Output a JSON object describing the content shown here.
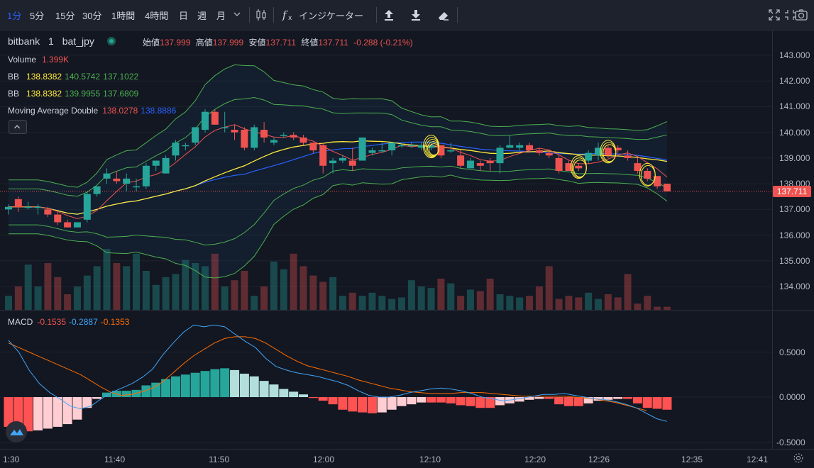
{
  "toolbar": {
    "intervals": [
      "1分",
      "5分",
      "15分",
      "30分",
      "1時間",
      "4時間",
      "日",
      "週",
      "月"
    ],
    "active_interval": "1分",
    "indicators_label": "インジケーター",
    "icons": [
      "chevron-down-icon",
      "candles-icon",
      "fx-icon",
      "upload-icon",
      "download-icon",
      "eraser-icon",
      "fullscreen-icon",
      "restore-icon",
      "camera-icon"
    ]
  },
  "symbol": {
    "exchange": "bitbank",
    "interval": "1",
    "pair": "bat_jpy"
  },
  "ohlc": {
    "open_label": "始値",
    "open": "137.999",
    "high_label": "高値",
    "high": "137.999",
    "low_label": "安値",
    "low": "137.711",
    "close_label": "終値",
    "close": "137.711",
    "change": "-0.288 (-0.21%)"
  },
  "legends": {
    "volume": {
      "label": "Volume",
      "value": "1.399K"
    },
    "bb1": {
      "label": "BB",
      "v1": "138.8382",
      "v2": "140.5742",
      "v3": "137.1022"
    },
    "bb2": {
      "label": "BB",
      "v1": "138.8382",
      "v2": "139.9955",
      "v3": "137.6809"
    },
    "mad": {
      "label": "Moving Average Double",
      "v1": "138.0278",
      "v2": "138.8886"
    },
    "macd": {
      "label": "MACD",
      "v1": "-0.1535",
      "v2": "-0.2887",
      "v3": "-0.1353"
    }
  },
  "price_scale": [
    "143.000",
    "142.000",
    "141.000",
    "140.000",
    "139.000",
    "138.000",
    "137.000",
    "136.000",
    "135.000",
    "134.000"
  ],
  "last_price": "137.711",
  "macd_scale": [
    "0.5000",
    "0.0000",
    "-0.5000"
  ],
  "time_scale": [
    "1:30",
    "11:40",
    "11:50",
    "12:00",
    "12:10",
    "12:20",
    "12:26",
    "12:35",
    "12:41"
  ],
  "colors": {
    "up": "#26a69a",
    "down": "#ef5350",
    "bb_mid": "#ffeb3b",
    "bb_band": "#4caf50",
    "ma_fast": "#ef5350",
    "ma_slow": "#2962ff",
    "macd_line": "#42a5f5",
    "signal_line": "#ff6d00",
    "annotation": "#ffeb3b"
  },
  "chart_data": {
    "type": "candlestick",
    "interval": "1 minute",
    "ylim": [
      133.5,
      143.3
    ],
    "candles": [
      {
        "o": 137.0,
        "h": 137.2,
        "l": 136.8,
        "c": 137.1
      },
      {
        "o": 137.4,
        "h": 137.5,
        "l": 136.9,
        "c": 137.1
      },
      {
        "o": 137.1,
        "h": 137.3,
        "l": 137.0,
        "c": 137.1
      },
      {
        "o": 137.1,
        "h": 137.2,
        "l": 136.8,
        "c": 137.1
      },
      {
        "o": 137.0,
        "h": 137.1,
        "l": 136.7,
        "c": 136.8
      },
      {
        "o": 136.8,
        "h": 136.9,
        "l": 136.4,
        "c": 136.5
      },
      {
        "o": 136.5,
        "h": 136.6,
        "l": 136.3,
        "c": 136.3
      },
      {
        "o": 136.3,
        "h": 136.5,
        "l": 136.3,
        "c": 136.5
      },
      {
        "o": 136.6,
        "h": 137.7,
        "l": 136.5,
        "c": 137.6
      },
      {
        "o": 137.6,
        "h": 137.9,
        "l": 137.5,
        "c": 137.9
      },
      {
        "o": 138.2,
        "h": 138.6,
        "l": 138.0,
        "c": 138.4
      },
      {
        "o": 138.2,
        "h": 138.5,
        "l": 138.0,
        "c": 138.1
      },
      {
        "o": 138.0,
        "h": 138.4,
        "l": 137.7,
        "c": 138.2
      },
      {
        "o": 137.9,
        "h": 138.2,
        "l": 137.7,
        "c": 137.9
      },
      {
        "o": 137.9,
        "h": 138.8,
        "l": 137.8,
        "c": 138.7
      },
      {
        "o": 138.7,
        "h": 138.9,
        "l": 138.5,
        "c": 138.9
      },
      {
        "o": 138.4,
        "h": 139.1,
        "l": 138.4,
        "c": 139.0
      },
      {
        "o": 139.1,
        "h": 139.7,
        "l": 138.9,
        "c": 139.6
      },
      {
        "o": 139.5,
        "h": 139.6,
        "l": 139.3,
        "c": 139.5
      },
      {
        "o": 139.6,
        "h": 140.2,
        "l": 139.5,
        "c": 140.2
      },
      {
        "o": 140.1,
        "h": 140.9,
        "l": 140.0,
        "c": 140.8
      },
      {
        "o": 140.8,
        "h": 140.9,
        "l": 140.3,
        "c": 140.3
      },
      {
        "o": 140.2,
        "h": 140.8,
        "l": 140.0,
        "c": 140.2
      },
      {
        "o": 140.1,
        "h": 140.3,
        "l": 139.7,
        "c": 140.0
      },
      {
        "o": 140.1,
        "h": 140.2,
        "l": 139.3,
        "c": 139.4
      },
      {
        "o": 139.4,
        "h": 140.3,
        "l": 139.3,
        "c": 140.2
      },
      {
        "o": 140.1,
        "h": 140.4,
        "l": 139.6,
        "c": 139.8
      },
      {
        "o": 139.6,
        "h": 139.8,
        "l": 139.5,
        "c": 139.7
      },
      {
        "o": 139.9,
        "h": 140.0,
        "l": 139.8,
        "c": 139.9
      },
      {
        "o": 139.9,
        "h": 140.0,
        "l": 139.7,
        "c": 139.8
      },
      {
        "o": 139.8,
        "h": 139.9,
        "l": 139.5,
        "c": 139.6
      },
      {
        "o": 139.6,
        "h": 139.6,
        "l": 139.2,
        "c": 139.3
      },
      {
        "o": 139.5,
        "h": 139.6,
        "l": 138.4,
        "c": 138.7
      },
      {
        "o": 138.8,
        "h": 139.0,
        "l": 138.4,
        "c": 138.9
      },
      {
        "o": 138.9,
        "h": 139.1,
        "l": 138.8,
        "c": 139.0
      },
      {
        "o": 138.9,
        "h": 139.4,
        "l": 138.5,
        "c": 138.7
      },
      {
        "o": 138.9,
        "h": 139.8,
        "l": 138.9,
        "c": 139.8
      },
      {
        "o": 139.2,
        "h": 139.4,
        "l": 139.1,
        "c": 139.3
      },
      {
        "o": 139.3,
        "h": 139.6,
        "l": 139.2,
        "c": 139.3
      },
      {
        "o": 139.3,
        "h": 139.6,
        "l": 139.1,
        "c": 139.6
      },
      {
        "o": 139.5,
        "h": 139.6,
        "l": 139.4,
        "c": 139.5
      },
      {
        "o": 139.5,
        "h": 139.6,
        "l": 139.4,
        "c": 139.5
      },
      {
        "o": 139.4,
        "h": 139.6,
        "l": 139.3,
        "c": 139.5
      },
      {
        "o": 139.4,
        "h": 139.6,
        "l": 139.3,
        "c": 139.5
      },
      {
        "o": 139.5,
        "h": 139.5,
        "l": 139.0,
        "c": 139.1
      },
      {
        "o": 139.3,
        "h": 139.6,
        "l": 139.2,
        "c": 139.3
      },
      {
        "o": 139.1,
        "h": 139.3,
        "l": 138.6,
        "c": 138.7
      },
      {
        "o": 138.6,
        "h": 139.0,
        "l": 138.6,
        "c": 138.9
      },
      {
        "o": 138.8,
        "h": 138.9,
        "l": 138.5,
        "c": 138.7
      },
      {
        "o": 138.9,
        "h": 139.0,
        "l": 138.5,
        "c": 138.8
      },
      {
        "o": 138.8,
        "h": 139.5,
        "l": 138.4,
        "c": 139.4
      },
      {
        "o": 139.4,
        "h": 139.9,
        "l": 139.4,
        "c": 139.5
      },
      {
        "o": 139.4,
        "h": 139.6,
        "l": 139.3,
        "c": 139.5
      },
      {
        "o": 139.5,
        "h": 139.6,
        "l": 139.2,
        "c": 139.3
      },
      {
        "o": 139.3,
        "h": 139.4,
        "l": 139.1,
        "c": 139.2
      },
      {
        "o": 139.2,
        "h": 139.3,
        "l": 139.0,
        "c": 139.1
      },
      {
        "o": 139.0,
        "h": 139.1,
        "l": 138.4,
        "c": 138.5
      },
      {
        "o": 138.8,
        "h": 138.9,
        "l": 138.5,
        "c": 138.5
      },
      {
        "o": 138.7,
        "h": 138.8,
        "l": 138.5,
        "c": 138.6
      },
      {
        "o": 138.9,
        "h": 139.3,
        "l": 138.8,
        "c": 139.2
      },
      {
        "o": 139.1,
        "h": 139.6,
        "l": 138.9,
        "c": 139.4
      },
      {
        "o": 139.4,
        "h": 139.5,
        "l": 139.0,
        "c": 139.1
      },
      {
        "o": 139.4,
        "h": 139.5,
        "l": 139.2,
        "c": 139.3
      },
      {
        "o": 139.1,
        "h": 139.3,
        "l": 138.9,
        "c": 139.0
      },
      {
        "o": 138.8,
        "h": 139.0,
        "l": 138.4,
        "c": 138.5
      },
      {
        "o": 138.5,
        "h": 138.6,
        "l": 138.1,
        "c": 138.2
      },
      {
        "o": 138.3,
        "h": 138.3,
        "l": 137.8,
        "c": 137.9
      },
      {
        "o": 138.0,
        "h": 138.0,
        "l": 137.7,
        "c": 137.7
      }
    ],
    "volume": [
      0.9,
      1.5,
      2.9,
      1.5,
      3.0,
      2.1,
      1.0,
      1.5,
      2.2,
      2.8,
      3.9,
      3.0,
      2.8,
      3.6,
      2.5,
      1.6,
      2.1,
      2.3,
      3.2,
      3.0,
      2.8,
      3.6,
      1.5,
      1.9,
      2.5,
      0.9,
      1.5,
      3.1,
      2.6,
      3.6,
      2.8,
      2.2,
      1.8,
      2.1,
      0.9,
      1.1,
      0.9,
      1.1,
      0.9,
      0.7,
      0.8,
      1.9,
      1.5,
      1.4,
      2.0,
      1.7,
      0.9,
      1.3,
      1.2,
      2.0,
      1.0,
      0.9,
      0.8,
      0.9,
      1.5,
      2.8,
      0.7,
      0.9,
      0.8,
      1.1,
      0.7,
      1.0,
      0.8,
      2.3,
      0.4,
      0.9,
      0.2,
      0.2
    ],
    "macd_ylim": [
      -0.55,
      0.95
    ],
    "macd_hist": [
      -0.33,
      -0.36,
      -0.38,
      -0.37,
      -0.35,
      -0.33,
      -0.3,
      -0.25,
      -0.12,
      -0.02,
      0.05,
      0.07,
      0.07,
      0.08,
      0.13,
      0.16,
      0.2,
      0.23,
      0.25,
      0.27,
      0.29,
      0.31,
      0.32,
      0.3,
      0.26,
      0.23,
      0.18,
      0.14,
      0.09,
      0.06,
      0.03,
      -0.01,
      -0.04,
      -0.08,
      -0.14,
      -0.16,
      -0.17,
      -0.18,
      -0.17,
      -0.14,
      -0.1,
      -0.08,
      -0.06,
      -0.06,
      -0.06,
      -0.07,
      -0.09,
      -0.1,
      -0.12,
      -0.12,
      -0.09,
      -0.07,
      -0.05,
      -0.03,
      -0.02,
      -0.02,
      -0.08,
      -0.1,
      -0.1,
      -0.07,
      -0.04,
      -0.03,
      -0.02,
      -0.02,
      -0.07,
      -0.12,
      -0.13,
      -0.14
    ],
    "macd_line": [
      0.63,
      0.5,
      0.3,
      0.15,
      0.05,
      -0.02,
      -0.1,
      -0.13,
      -0.1,
      -0.02,
      0.05,
      0.1,
      0.15,
      0.22,
      0.31,
      0.47,
      0.6,
      0.72,
      0.8,
      0.78,
      0.8,
      0.78,
      0.7,
      0.62,
      0.55,
      0.43,
      0.34,
      0.3,
      0.27,
      0.25,
      0.23,
      0.2,
      0.17,
      0.13,
      0.07,
      0.02,
      0.0,
      0.0,
      0.02,
      0.05,
      0.07,
      0.09,
      0.1,
      0.09,
      0.07,
      0.04,
      0.0,
      -0.02,
      -0.04,
      -0.03,
      -0.01,
      0.01,
      0.03,
      0.03,
      0.04,
      0.02,
      0.0,
      -0.02,
      -0.03,
      -0.05,
      -0.08,
      -0.12,
      -0.18,
      -0.24,
      -0.27
    ],
    "signal_line": [
      0.6,
      0.55,
      0.5,
      0.45,
      0.4,
      0.35,
      0.3,
      0.25,
      0.18,
      0.11,
      0.05,
      0.02,
      0.03,
      0.06,
      0.1,
      0.17,
      0.27,
      0.37,
      0.46,
      0.53,
      0.6,
      0.65,
      0.67,
      0.67,
      0.65,
      0.6,
      0.53,
      0.46,
      0.4,
      0.35,
      0.32,
      0.29,
      0.26,
      0.23,
      0.19,
      0.16,
      0.13,
      0.1,
      0.08,
      0.06,
      0.05,
      0.04,
      0.04,
      0.04,
      0.05,
      0.05,
      0.05,
      0.04,
      0.03,
      0.02,
      0.01,
      0.01,
      0.01,
      0.01,
      0.01,
      0.0,
      -0.01,
      -0.02,
      -0.04,
      -0.06,
      -0.09,
      -0.12,
      -0.15
    ]
  }
}
